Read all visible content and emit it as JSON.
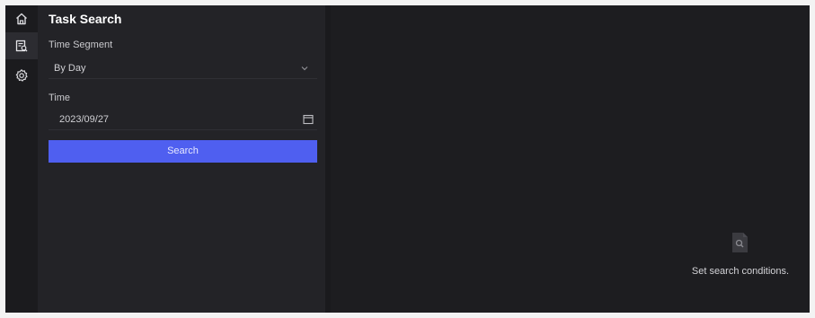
{
  "nav": {
    "items": [
      {
        "icon": "home-icon",
        "active": false
      },
      {
        "icon": "task-search-icon",
        "active": true
      },
      {
        "icon": "settings-icon",
        "active": false
      }
    ]
  },
  "panel": {
    "title": "Task Search",
    "time_segment": {
      "label": "Time Segment",
      "value": "By Day",
      "icon": "chevron-down-icon"
    },
    "time": {
      "label": "Time",
      "value": "2023/09/27",
      "icon": "calendar-icon"
    },
    "search_label": "Search"
  },
  "main": {
    "empty_icon": "document-search-icon",
    "empty_text": "Set search conditions."
  },
  "colors": {
    "accent": "#4f5ff0",
    "background": "#1d1d20",
    "panel": "#232327"
  }
}
